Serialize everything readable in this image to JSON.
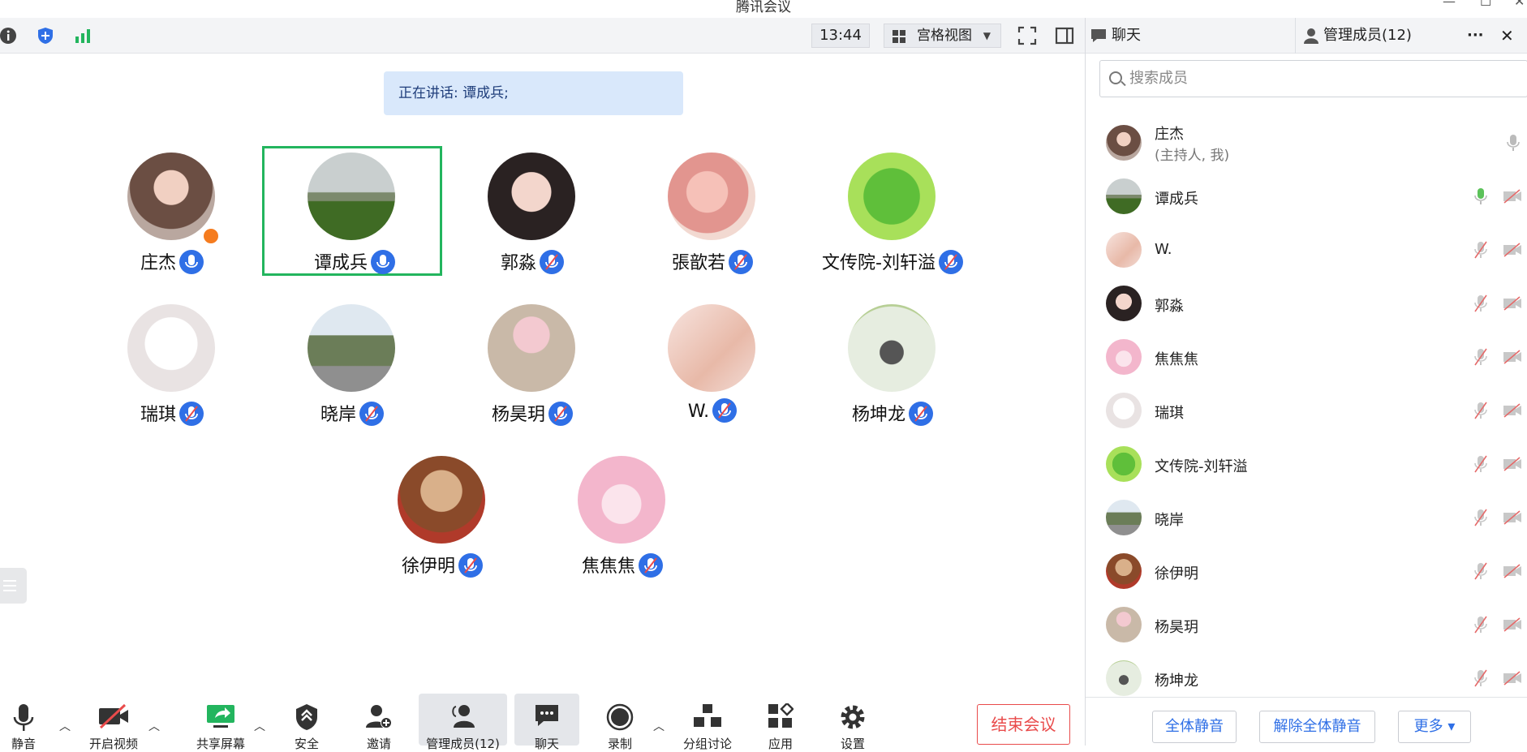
{
  "window": {
    "title": "腾讯会议"
  },
  "topbar": {
    "time": "13:44",
    "view_label": "宫格视图"
  },
  "speaking": "正在讲话: 谭成兵;",
  "tiles": [
    {
      "name": "庄杰"
    },
    {
      "name": "谭成兵"
    },
    {
      "name": "郭淼"
    },
    {
      "name": "張歆若"
    },
    {
      "name": "文传院-刘轩溢"
    },
    {
      "name": "瑞琪"
    },
    {
      "name": "晓岸"
    },
    {
      "name": "杨昊玥"
    },
    {
      "name": "W."
    },
    {
      "name": "杨坤龙"
    },
    {
      "name": "徐伊明"
    },
    {
      "name": "焦焦焦"
    }
  ],
  "bottombar": {
    "mute": "静音",
    "video": "开启视频",
    "share": "共享屏幕",
    "security": "安全",
    "invite": "邀请",
    "members": "管理成员(12)",
    "chat": "聊天",
    "record": "录制",
    "breakout": "分组讨论",
    "apps": "应用",
    "settings": "设置",
    "end": "结束会议"
  },
  "side": {
    "tab_chat": "聊天",
    "tab_members": "管理成员(12)",
    "more": "···",
    "close": "✕",
    "search_placeholder": "搜索成员",
    "members": [
      {
        "name": "庄杰",
        "role": "(主持人, 我)"
      },
      {
        "name": "谭成兵"
      },
      {
        "name": "W."
      },
      {
        "name": "郭淼"
      },
      {
        "name": "焦焦焦"
      },
      {
        "name": "瑞琪"
      },
      {
        "name": "文传院-刘轩溢"
      },
      {
        "name": "晓岸"
      },
      {
        "name": "徐伊明"
      },
      {
        "name": "杨昊玥"
      },
      {
        "name": "杨坤龙"
      }
    ],
    "mute_all": "全体静音",
    "unmute_all": "解除全体静音",
    "more_btn": "更多 ▾"
  },
  "colors": {
    "accent": "#2f6fe6",
    "active_border": "#23b55e",
    "end_red": "#e94b4b",
    "speaking_bg": "#d9e8fb"
  }
}
